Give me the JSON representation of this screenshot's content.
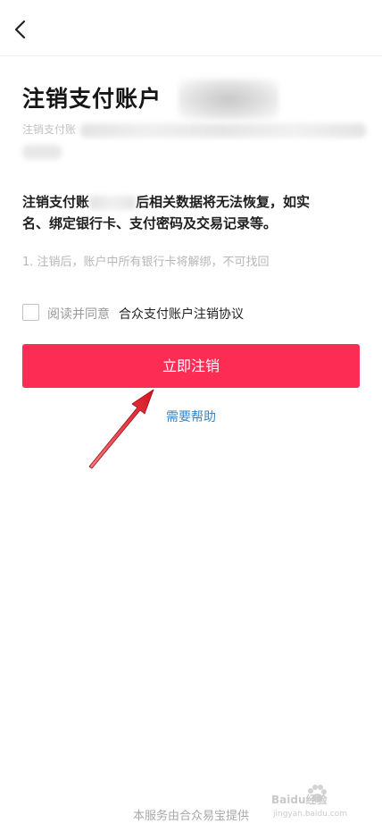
{
  "header": {
    "back_icon": "chevron-left-icon"
  },
  "page": {
    "title": "注销支付账户",
    "subtitle": "注销支付账"
  },
  "warning": {
    "line1_start": "注销支付账",
    "line1_end": "后相关数据将无法恢复，如实",
    "line2": "名、绑定银行卡、支付密码及交易记录等。"
  },
  "note": "1. 注销后，账户中所有银行卡将解绑，不可找回",
  "agreement": {
    "prefix": "阅读并同意",
    "link": "合众支付账户注销协议",
    "checked": false
  },
  "primary_button": {
    "label": "立即注销",
    "color": "#fd2c55"
  },
  "help_link": {
    "label": "需要帮助",
    "color": "#3a86c4"
  },
  "footer": "本服务由合众易宝提供",
  "watermark": {
    "brand": "Baidu经验",
    "url": "jingyan.baidu.com"
  },
  "annotation": {
    "arrow_color": "#e0202a"
  }
}
